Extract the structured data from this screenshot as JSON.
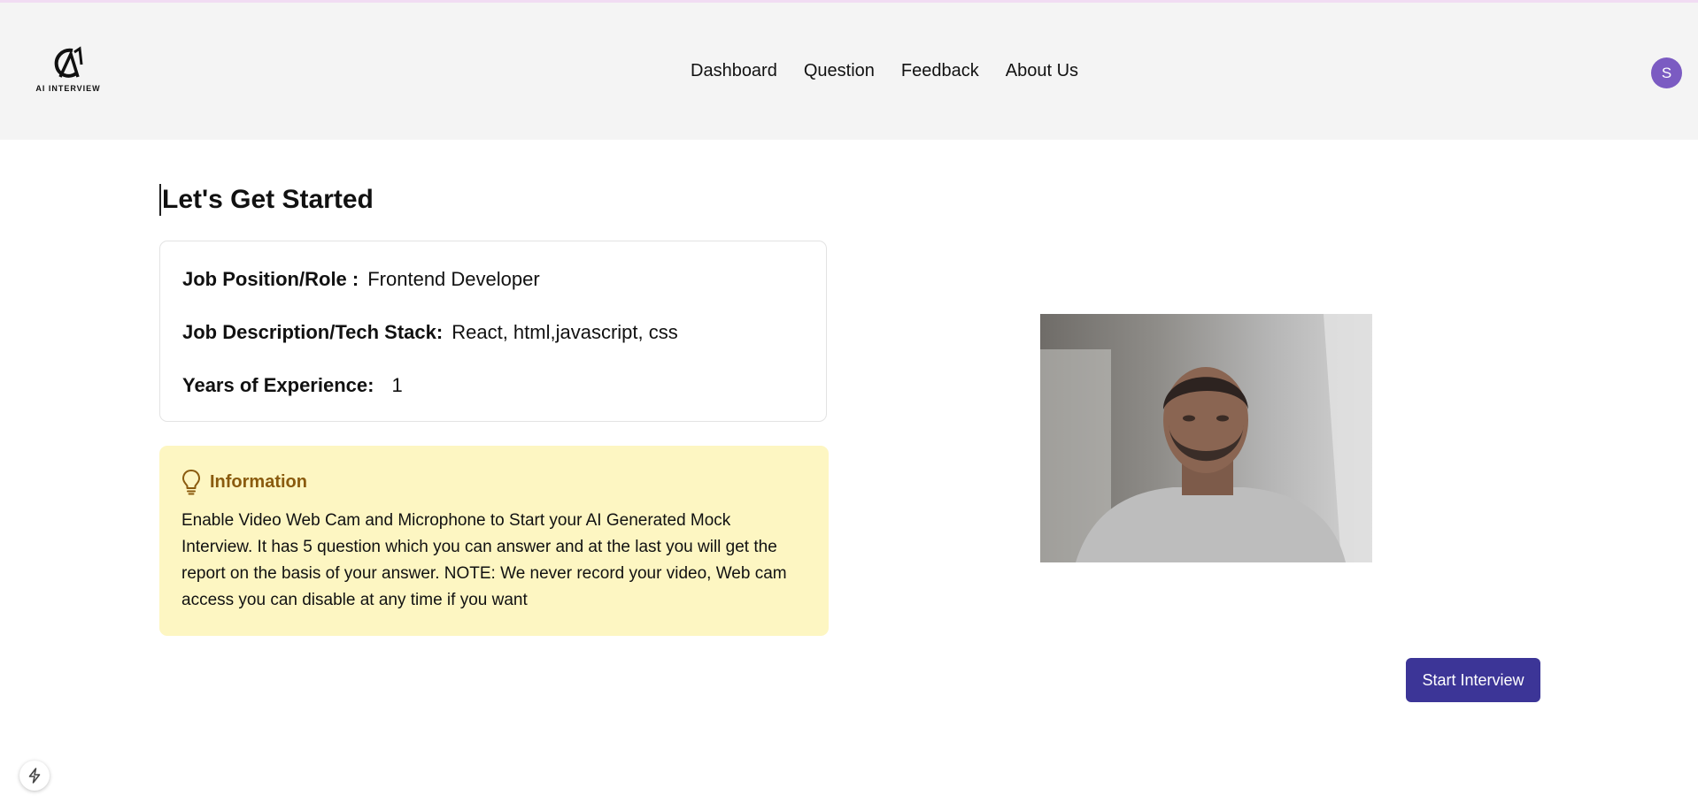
{
  "brand": {
    "logo_text": "AI INTERVIEW"
  },
  "nav": [
    {
      "label": "Dashboard"
    },
    {
      "label": "Question"
    },
    {
      "label": "Feedback"
    },
    {
      "label": "About Us"
    }
  ],
  "user": {
    "avatar_initial": "S",
    "avatar_color": "#7b5bc2"
  },
  "page": {
    "title": "Let's Get Started"
  },
  "details": {
    "position_label": "Job Position/Role :",
    "position_value": "Frontend Developer",
    "description_label": "Job Description/Tech Stack:",
    "description_value": "React, html,javascript, css",
    "experience_label": "Years of Experience:",
    "experience_value": "1"
  },
  "info": {
    "icon": "lightbulb-icon",
    "title": "Information",
    "body": "Enable Video Web Cam and Microphone to Start your AI Generated Mock Interview. It has 5 question which you can answer and at the last you will get the report on the basis of your answer. NOTE: We never record your video, Web cam access you can disable at any time if you want"
  },
  "actions": {
    "start_label": "Start Interview"
  },
  "colors": {
    "header_bg": "#f4f4f4",
    "info_bg": "#fdf6c2",
    "info_accent": "#8a5b0e",
    "button_bg": "#3c3597"
  }
}
